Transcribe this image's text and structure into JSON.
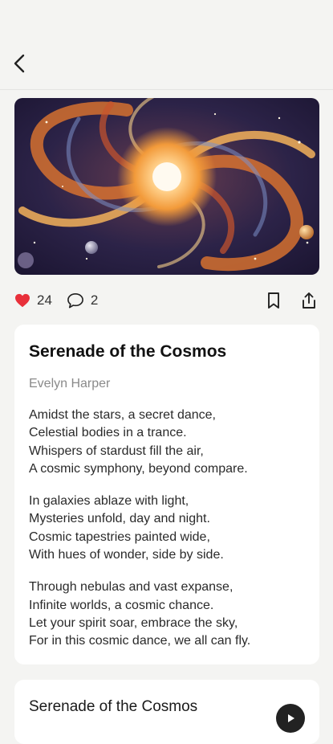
{
  "header": {
    "back_icon": "chevron-left-icon"
  },
  "hero": {
    "image": "spiral-galaxy-painting"
  },
  "actions": {
    "likes": "24",
    "comments": "2",
    "like_color": "#e8303a"
  },
  "poem": {
    "title": "Serenade of the Cosmos",
    "author": "Evelyn Harper",
    "stanzas": [
      [
        "Amidst the stars, a secret dance,",
        "Celestial bodies in a trance.",
        "Whispers of stardust fill the air,",
        "A cosmic symphony, beyond compare."
      ],
      [
        "In galaxies ablaze with light,",
        "Mysteries unfold, day and night.",
        "Cosmic tapestries painted wide,",
        "With hues of wonder, side by side."
      ],
      [
        "Through nebulas and vast expanse,",
        "Infinite worlds, a cosmic chance.",
        "Let your spirit soar, embrace the sky,",
        "For in this cosmic dance, we all can fly."
      ]
    ]
  },
  "player": {
    "title": "Serenade of the Cosmos"
  }
}
